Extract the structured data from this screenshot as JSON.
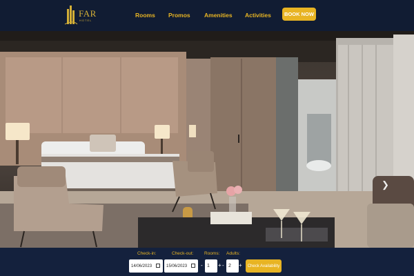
{
  "brand": {
    "name": "FAR",
    "subtitle": "HOTEL",
    "accent_color": "#e8b423"
  },
  "nav": {
    "links": [
      {
        "label": "Rooms"
      },
      {
        "label": "Promos"
      },
      {
        "label": "Amenities"
      },
      {
        "label": "Activities"
      }
    ],
    "book_now_label": "BOOK NOW"
  },
  "hero": {
    "next_icon": "chevron-right-icon"
  },
  "booking": {
    "checkin_label": "Check-in:",
    "checkin_value": "14/06/2023",
    "checkout_label": "Check-out:",
    "checkout_value": "15/06/2023",
    "rooms_label": "Rooms:",
    "rooms_value": "1",
    "adults_label": "Adults:",
    "adults_value": "2",
    "minus_symbol": "-",
    "plus_symbol": "+",
    "check_label": "Check Availability"
  }
}
